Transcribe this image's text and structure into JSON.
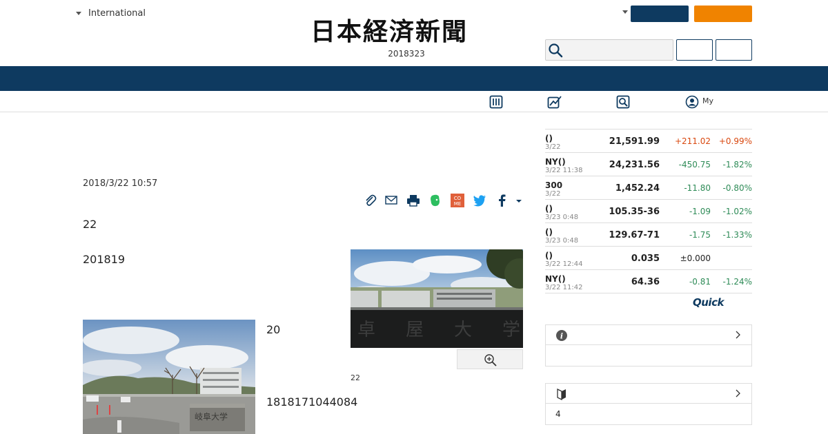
{
  "header": {
    "edition_label": "International",
    "logo_text": "日本経済新聞",
    "date": "2018323",
    "account_button": "",
    "subscribe_button": "",
    "search_placeholder": "",
    "login_button": "",
    "register_button": ""
  },
  "colors": {
    "navy": "#0e3a60",
    "orange": "#f08300",
    "up": "#d9480f",
    "down": "#2e8b57"
  },
  "subnav": {
    "items": [
      {
        "icon": "ranking-icon",
        "label": ""
      },
      {
        "icon": "chart-icon",
        "label": ""
      },
      {
        "icon": "search-news-icon",
        "label": ""
      },
      {
        "icon": "user-icon",
        "label": "My"
      }
    ]
  },
  "article": {
    "date": "2018/3/22 10:57",
    "paragraphs": [
      "22",
      "201819",
      "20",
      "1818171044084"
    ],
    "photo_caption": "22",
    "share_icons": [
      "clip-icon",
      "mail-icon",
      "print-icon",
      "evernote-icon",
      "come-icon",
      "twitter-icon",
      "facebook-icon",
      "more-caret-icon"
    ]
  },
  "market": {
    "rows": [
      {
        "name": "()",
        "time": "3/22",
        "value": "21,591.99",
        "change": "+211.02",
        "pct": "+0.99%",
        "dir": "up"
      },
      {
        "name": "NY()",
        "time": "3/22 11:38",
        "value": "24,231.56",
        "change": "-450.75",
        "pct": "-1.82%",
        "dir": "down"
      },
      {
        "name": "300",
        "time": "3/22",
        "value": "1,452.24",
        "change": "-11.80",
        "pct": "-0.80%",
        "dir": "down"
      },
      {
        "name": "()",
        "time": "3/23 0:48",
        "value": "105.35-36",
        "change": "-1.09",
        "pct": "-1.02%",
        "dir": "down"
      },
      {
        "name": "()",
        "time": "3/23 0:48",
        "value": "129.67-71",
        "change": "-1.75",
        "pct": "-1.33%",
        "dir": "down"
      },
      {
        "name": "()",
        "time": "3/22 12:44",
        "value": "0.035",
        "change": "±0.000",
        "pct": "",
        "dir": "flat"
      },
      {
        "name": "NY()",
        "time": "3/22 11:42",
        "value": "64.36",
        "change": "-0.81",
        "pct": "-1.24%",
        "dir": "down"
      }
    ],
    "provider": "Quick"
  },
  "boxes": {
    "info": {
      "title": "",
      "body": ""
    },
    "beginner": {
      "title": "",
      "body": "4"
    }
  }
}
